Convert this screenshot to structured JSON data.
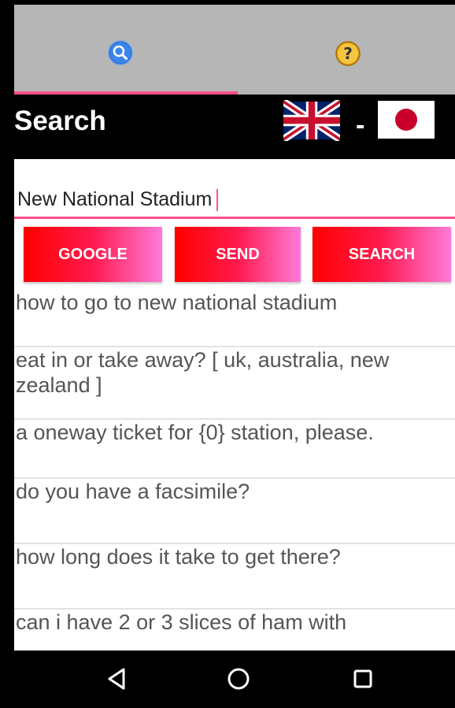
{
  "tabs": {
    "search_icon": "search-icon",
    "help_icon": "help-icon",
    "active": "search",
    "indicator_color": "#ff4f86"
  },
  "header": {
    "title": "Search",
    "source_language_flag": "uk-flag",
    "separator": "-",
    "target_language_flag": "japan-flag"
  },
  "search": {
    "value": "New National Stadium"
  },
  "buttons": {
    "google": "GOOGLE",
    "send": "SEND",
    "search": "SEARCH"
  },
  "results": [
    "how to go to new national stadium",
    "eat in or take away? [ uk, australia, new zealand ]",
    "a oneway ticket for {0} station, please.",
    "do you have a facsimile?",
    "how long does it take to get there?",
    "can i have 2 or 3 slices of ham with"
  ],
  "navbar": {
    "back_icon": "back-triangle-icon",
    "home_icon": "home-circle-icon",
    "recent_icon": "recents-square-icon"
  },
  "colors": {
    "accent": "#ff4f86",
    "button_gradient_start": "#ff0000",
    "button_gradient_end": "#ff7bd9",
    "tabbar": "#b6b6b6"
  }
}
